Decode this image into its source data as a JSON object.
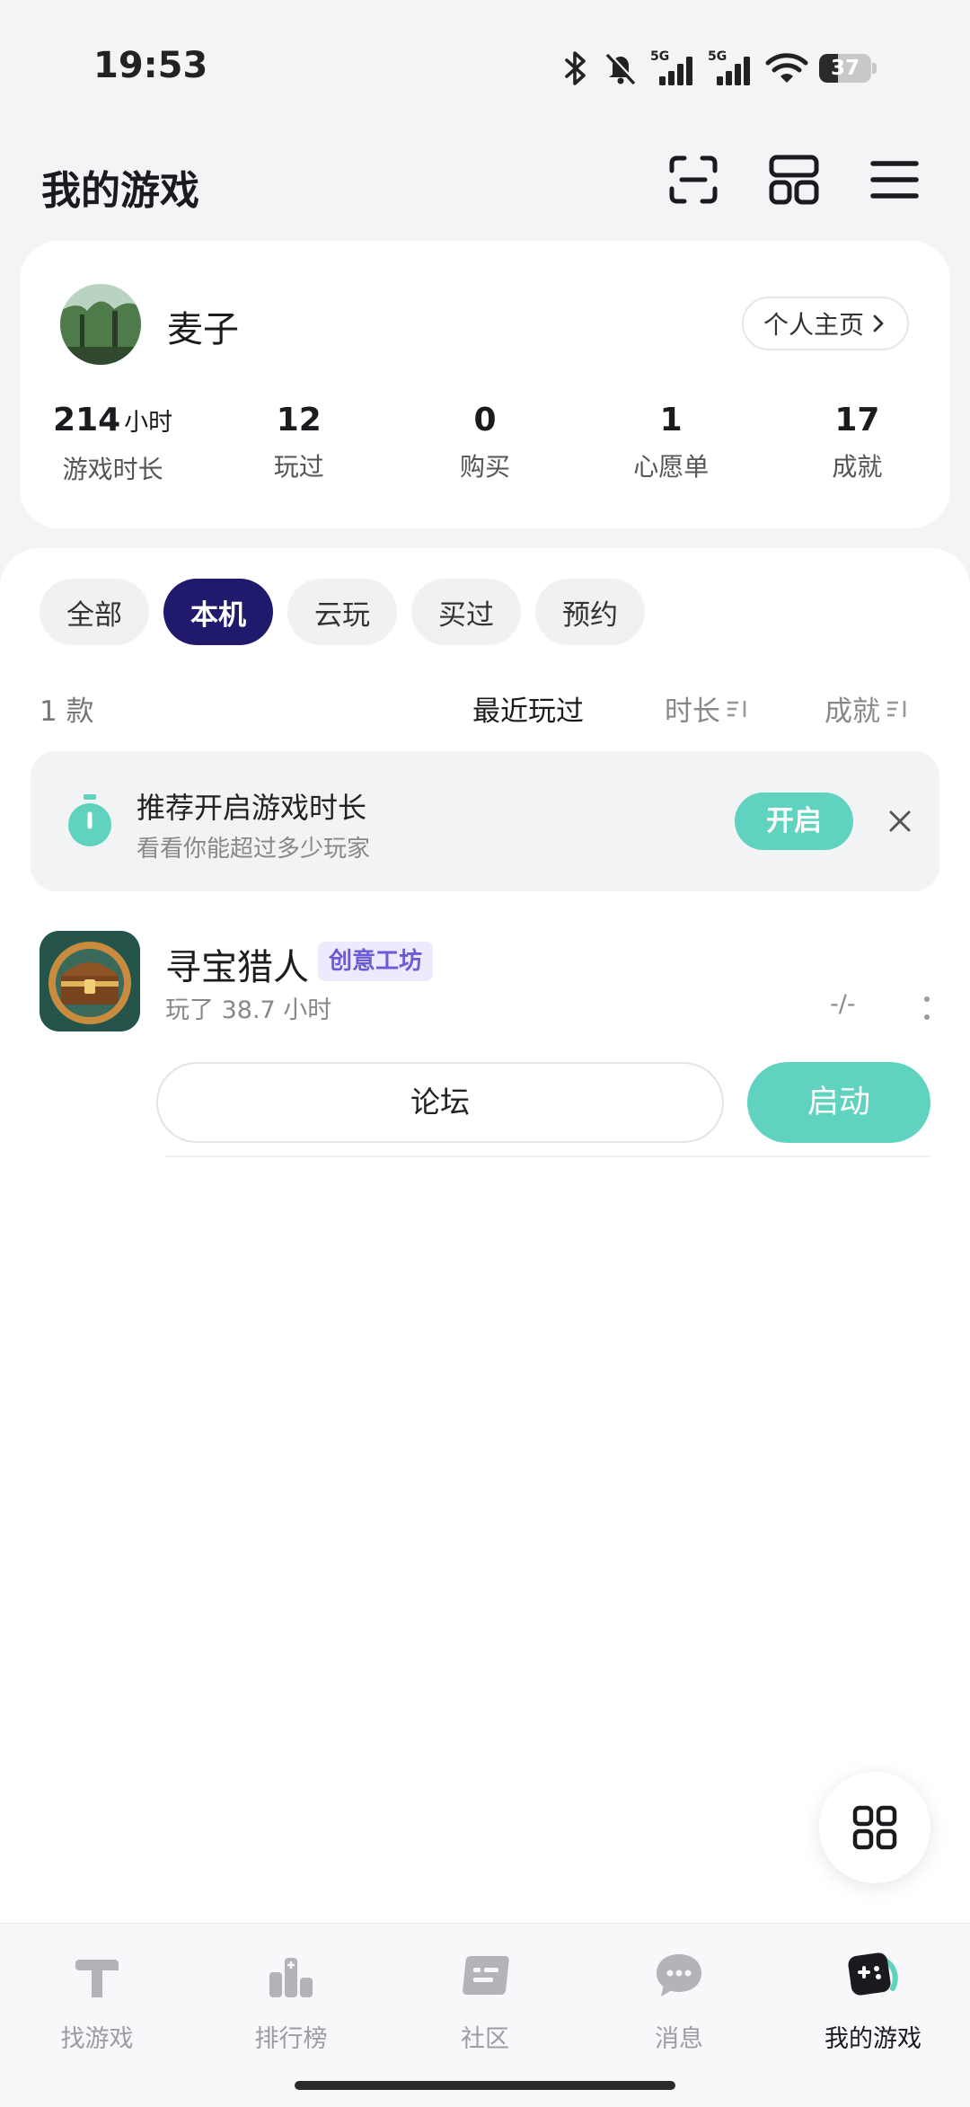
{
  "status_bar": {
    "time": "19:53",
    "signal_1_label": "5G",
    "signal_2_label": "5G",
    "battery": "37",
    "icons": [
      "bluetooth-icon",
      "mute-bell-icon",
      "signal-5g-icon",
      "signal-5g-icon",
      "wifi-icon",
      "battery-icon"
    ]
  },
  "header": {
    "title": "我的游戏",
    "actions": [
      "scan-icon",
      "layout-icon",
      "menu-icon"
    ]
  },
  "profile": {
    "name": "麦子",
    "home_link": "个人主页",
    "stats": [
      {
        "value": "214",
        "unit": "小时",
        "label": "游戏时长"
      },
      {
        "value": "12",
        "unit": "",
        "label": "玩过"
      },
      {
        "value": "0",
        "unit": "",
        "label": "购买"
      },
      {
        "value": "1",
        "unit": "",
        "label": "心愿单"
      },
      {
        "value": "17",
        "unit": "",
        "label": "成就"
      }
    ]
  },
  "filters": {
    "chips": [
      "全部",
      "本机",
      "云玩",
      "买过",
      "预约"
    ],
    "active": "本机"
  },
  "sort": {
    "count": "1 款",
    "options": [
      "最近玩过",
      "时长",
      "成就"
    ],
    "active": "最近玩过"
  },
  "banner": {
    "title": "推荐开启游戏时长",
    "subtitle": "看看你能超过多少玩家",
    "button": "开启"
  },
  "games": [
    {
      "title": "寻宝猎人",
      "tag": "创意工坊",
      "playtime": "玩了 38.7 小时",
      "extra": "-/-",
      "forum_button": "论坛",
      "launch_button": "启动"
    }
  ],
  "tabbar": {
    "items": [
      "找游戏",
      "排行榜",
      "社区",
      "消息",
      "我的游戏"
    ],
    "active": "我的游戏"
  },
  "colors": {
    "accent_teal": "#5fd3c0",
    "active_chip": "#1f1a6b",
    "tag_purple": "#6b5bd6"
  }
}
